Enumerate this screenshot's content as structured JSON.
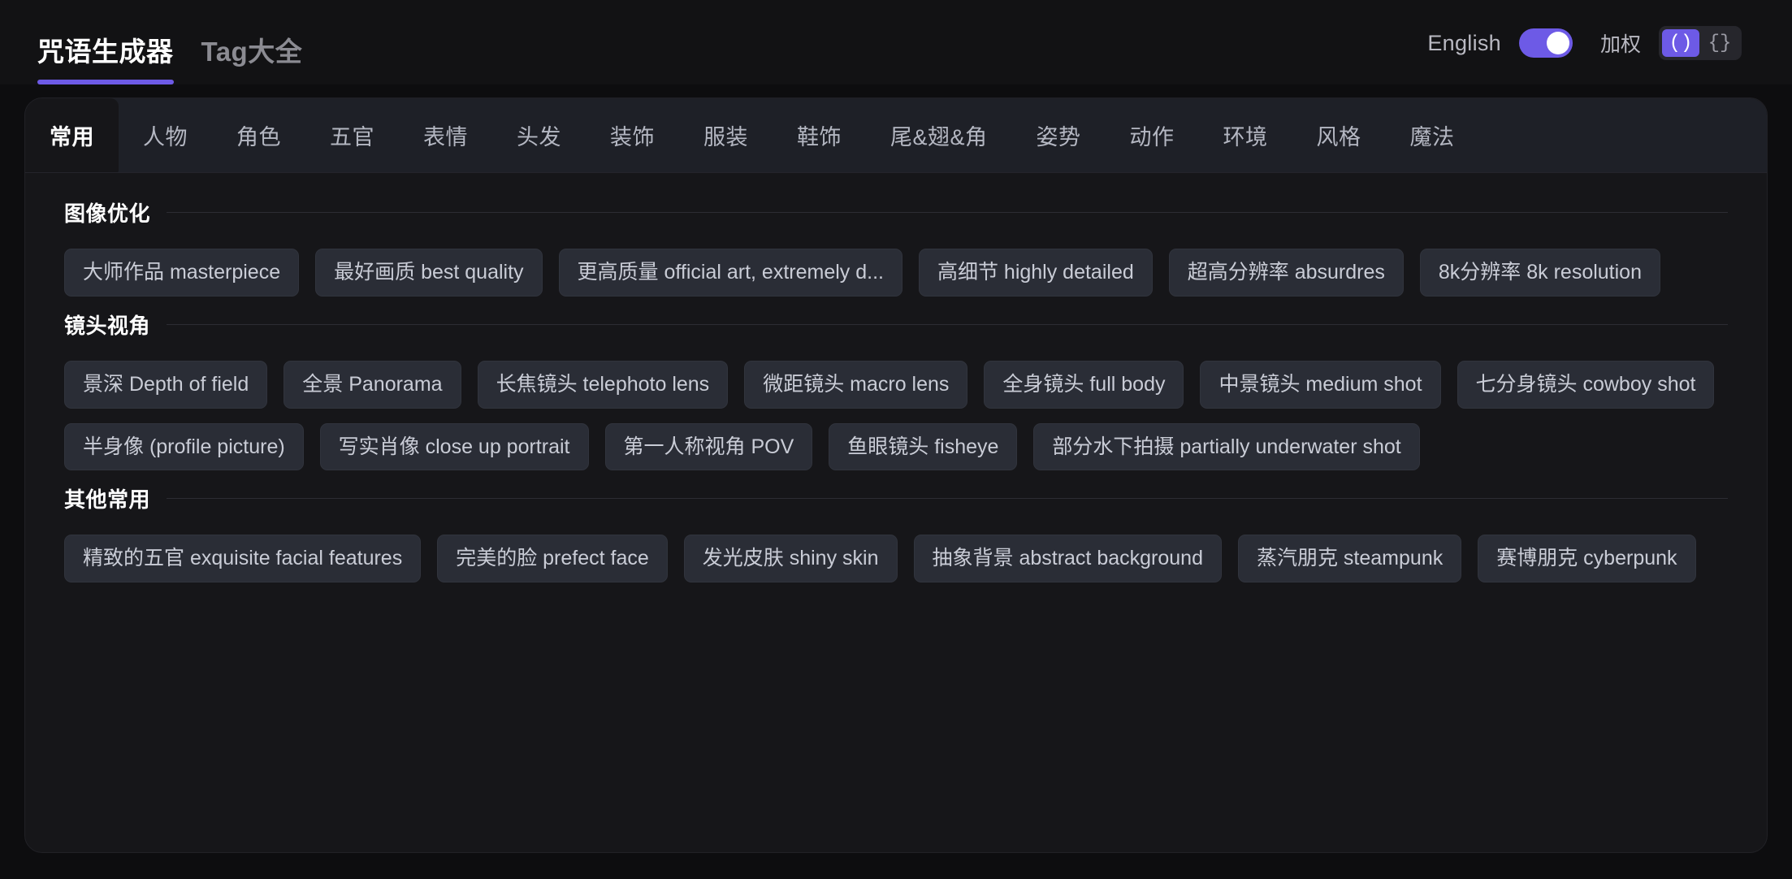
{
  "header": {
    "tabs": [
      {
        "label": "咒语生成器",
        "active": true
      },
      {
        "label": "Tag大全",
        "active": false
      }
    ],
    "language_label": "English",
    "language_toggle_on": true,
    "weight_label": "加权",
    "weight_options": [
      {
        "label": "()",
        "active": true
      },
      {
        "label": "{}",
        "active": false
      }
    ],
    "accent_color": "#6d5ae6"
  },
  "category_tabs": [
    {
      "label": "常用",
      "active": true
    },
    {
      "label": "人物",
      "active": false
    },
    {
      "label": "角色",
      "active": false
    },
    {
      "label": "五官",
      "active": false
    },
    {
      "label": "表情",
      "active": false
    },
    {
      "label": "头发",
      "active": false
    },
    {
      "label": "装饰",
      "active": false
    },
    {
      "label": "服装",
      "active": false
    },
    {
      "label": "鞋饰",
      "active": false
    },
    {
      "label": "尾&翅&角",
      "active": false
    },
    {
      "label": "姿势",
      "active": false
    },
    {
      "label": "动作",
      "active": false
    },
    {
      "label": "环境",
      "active": false
    },
    {
      "label": "风格",
      "active": false
    },
    {
      "label": "魔法",
      "active": false
    }
  ],
  "sections": [
    {
      "title": "图像优化",
      "rows": [
        [
          "大师作品 masterpiece",
          "最好画质 best quality",
          "更高质量 official art, extremely d...",
          "高细节 highly detailed",
          "超高分辨率 absurdres",
          "8k分辨率 8k resolution"
        ]
      ]
    },
    {
      "title": "镜头视角",
      "rows": [
        [
          "景深 Depth of field",
          "全景 Panorama",
          "长焦镜头 telephoto lens",
          "微距镜头 macro lens",
          "全身镜头 full body",
          "中景镜头 medium shot",
          "七分身镜头 cowboy shot"
        ],
        [
          "半身像 (profile picture)",
          "写实肖像 close up portrait",
          "第一人称视角 POV",
          "鱼眼镜头 fisheye",
          "部分水下拍摄 partially underwater shot"
        ]
      ]
    },
    {
      "title": "其他常用",
      "rows": [
        [
          "精致的五官 exquisite facial features",
          "完美的脸 prefect face",
          "发光皮肤 shiny skin",
          "抽象背景 abstract background",
          "蒸汽朋克 steampunk",
          "赛博朋克 cyberpunk"
        ]
      ]
    }
  ]
}
